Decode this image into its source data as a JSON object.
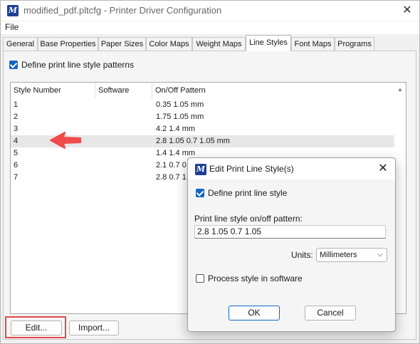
{
  "window": {
    "title": "modified_pdf.pltcfg - Printer Driver Configuration",
    "close_glyph": "✕"
  },
  "menu": {
    "file": "File"
  },
  "tabs": [
    {
      "label": "General"
    },
    {
      "label": "Base Properties"
    },
    {
      "label": "Paper Sizes"
    },
    {
      "label": "Color Maps"
    },
    {
      "label": "Weight Maps"
    },
    {
      "label": "Line Styles"
    },
    {
      "label": "Font Maps"
    },
    {
      "label": "Programs"
    }
  ],
  "active_tab": "Line Styles",
  "define_patterns": {
    "label": "Define print line style patterns",
    "checked": true
  },
  "table": {
    "columns": [
      "Style Number",
      "Software",
      "On/Off Pattern"
    ],
    "rows": [
      {
        "num": "1",
        "software": "",
        "pattern": "0.35 1.05 mm"
      },
      {
        "num": "2",
        "software": "",
        "pattern": "1.75 1.05 mm"
      },
      {
        "num": "3",
        "software": "",
        "pattern": "4.2 1.4 mm"
      },
      {
        "num": "4",
        "software": "",
        "pattern": "2.8 1.05 0.7 1.05 mm"
      },
      {
        "num": "5",
        "software": "",
        "pattern": "1.4 1.4 mm"
      },
      {
        "num": "6",
        "software": "",
        "pattern": "2.1 0.7 0."
      },
      {
        "num": "7",
        "software": "",
        "pattern": "2.8 0.7 1."
      }
    ],
    "selected_row": "4"
  },
  "buttons": {
    "edit": "Edit...",
    "import": "Import..."
  },
  "dialog": {
    "title": "Edit Print Line Style(s)",
    "close_glyph": "✕",
    "define_style": {
      "label": "Define print line style",
      "checked": true
    },
    "pattern_label": "Print line style on/off pattern:",
    "pattern_value": "2.8 1.05 0.7 1.05",
    "units_label": "Units:",
    "units_value": "Millimeters",
    "process_software": {
      "label": "Process style in software",
      "checked": false
    },
    "ok": "OK",
    "cancel": "Cancel"
  },
  "colors": {
    "accent": "#1266c4",
    "annotation_red": "#e5484d"
  },
  "icons": {
    "app": "microstation-icon",
    "arrow": "red-arrow-left-annotation",
    "dropdown": "chevron-down-icon"
  }
}
